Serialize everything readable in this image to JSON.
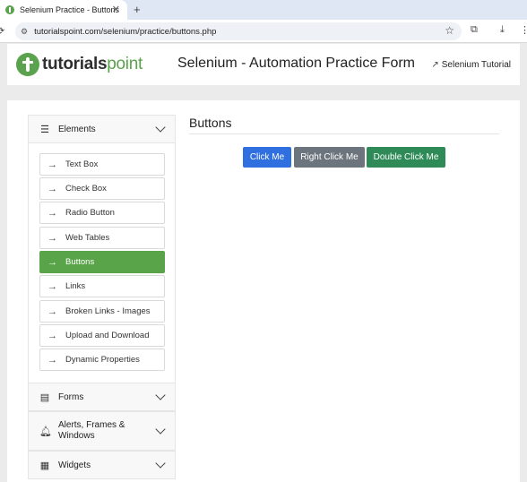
{
  "browser": {
    "tab_title": "Selenium Practice - Buttons",
    "tab_close": "✕",
    "new_tab": "+",
    "url": "tutorialspoint.com/selenium/practice/buttons.php"
  },
  "header": {
    "logo_part1": "tutorials",
    "logo_part2": "point",
    "title": "Selenium - Automation Practice Form",
    "tutorial_link": "Selenium Tutorial"
  },
  "sidebar": {
    "elements_label": "Elements",
    "items": [
      {
        "label": "Text Box"
      },
      {
        "label": "Check Box"
      },
      {
        "label": "Radio Button"
      },
      {
        "label": "Web Tables"
      },
      {
        "label": "Buttons",
        "active": true
      },
      {
        "label": "Links"
      },
      {
        "label": "Broken Links - Images"
      },
      {
        "label": "Upload and Download"
      },
      {
        "label": "Dynamic Properties"
      }
    ],
    "forms_label": "Forms",
    "alerts_label": "Alerts, Frames & Windows",
    "widgets_label": "Widgets"
  },
  "content": {
    "title": "Buttons",
    "buttons": {
      "click": "Click Me",
      "right_click": "Right Click Me",
      "double_click": "Double Click Me"
    }
  },
  "icons": {
    "reload": "reload-icon",
    "star": "star-icon",
    "extensions": "puzzle-icon",
    "download": "download-icon",
    "menu": "hamburger-icon",
    "arrow": "arrow-right-icon",
    "forms": "list-icon",
    "alerts": "bell-icon",
    "widgets": "grid-icon"
  },
  "colors": {
    "brand_green": "#5aa24d",
    "active_item": "#59a449",
    "click_button": "#2f6fe0",
    "right_click_button": "#6c757d",
    "double_click_button": "#2e8b57"
  }
}
